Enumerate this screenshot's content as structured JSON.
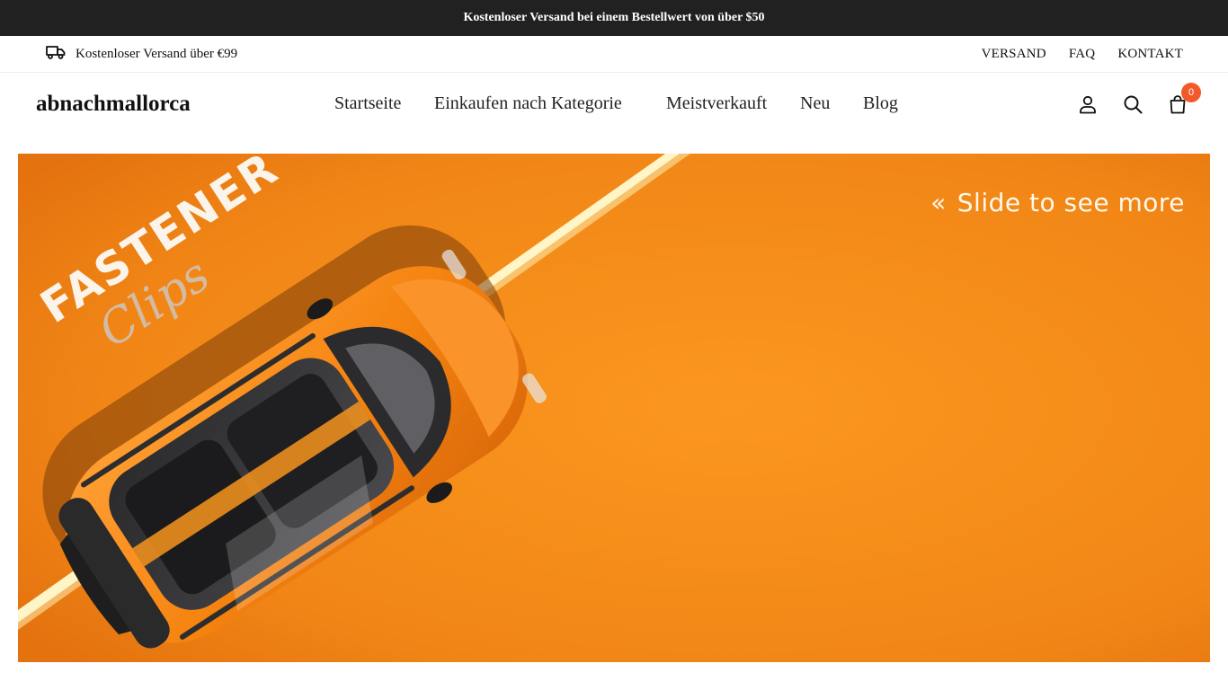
{
  "announcement": {
    "text": "Kostenloser Versand bei einem Bestellwert von über $50"
  },
  "utility": {
    "shipping_icon": "truck-icon",
    "shipping_text": "Kostenloser Versand über €99",
    "links": [
      {
        "label": "VERSAND"
      },
      {
        "label": "FAQ"
      },
      {
        "label": "KONTAKT"
      }
    ]
  },
  "header": {
    "logo": "abnachmallorca",
    "nav": [
      {
        "label": "Startseite"
      },
      {
        "label": "Einkaufen nach Kategorie"
      },
      {
        "label": "Meistverkauft"
      },
      {
        "label": "Neu"
      },
      {
        "label": "Blog"
      }
    ],
    "icons": {
      "account": "user-icon",
      "search": "search-icon",
      "cart": "cart-icon"
    },
    "cart_count": "0"
  },
  "hero": {
    "slide_hint": "Slide to see more",
    "slide_hint_icon": "«",
    "brand_line1": "FASTENER",
    "brand_line2": "Clips",
    "colors": {
      "background": "#f5891a",
      "stripe": "#fff7cc",
      "car_body": "#f7941d"
    }
  },
  "colors": {
    "announcement_bg": "#212121",
    "badge": "#f25a2a"
  }
}
